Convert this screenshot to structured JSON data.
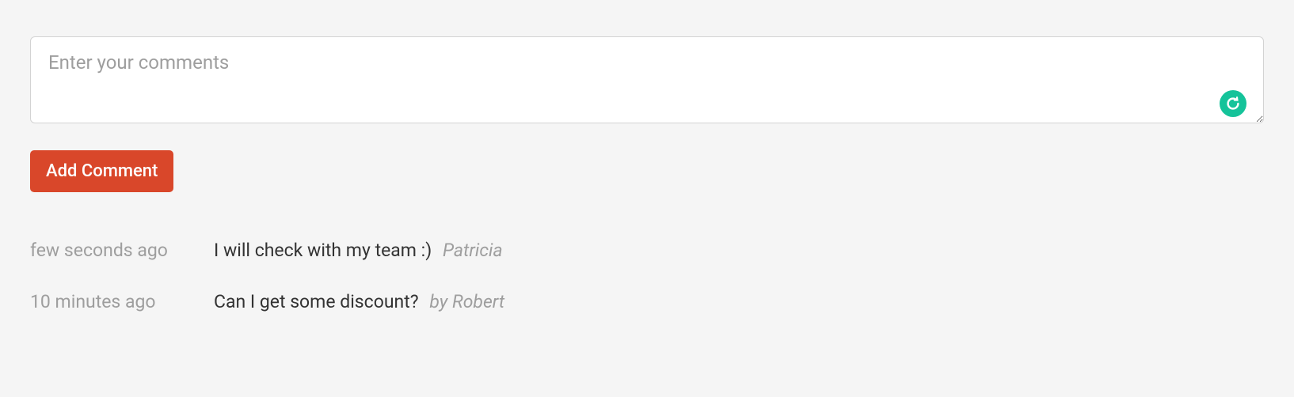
{
  "commentBox": {
    "placeholder": "Enter your comments",
    "value": ""
  },
  "addButton": {
    "label": "Add Comment"
  },
  "comments": [
    {
      "time": "few seconds ago",
      "text": "I will check with my team :)",
      "author": "Patricia"
    },
    {
      "time": "10 minutes ago",
      "text": "Can I get some discount?",
      "author": "by Robert"
    }
  ]
}
